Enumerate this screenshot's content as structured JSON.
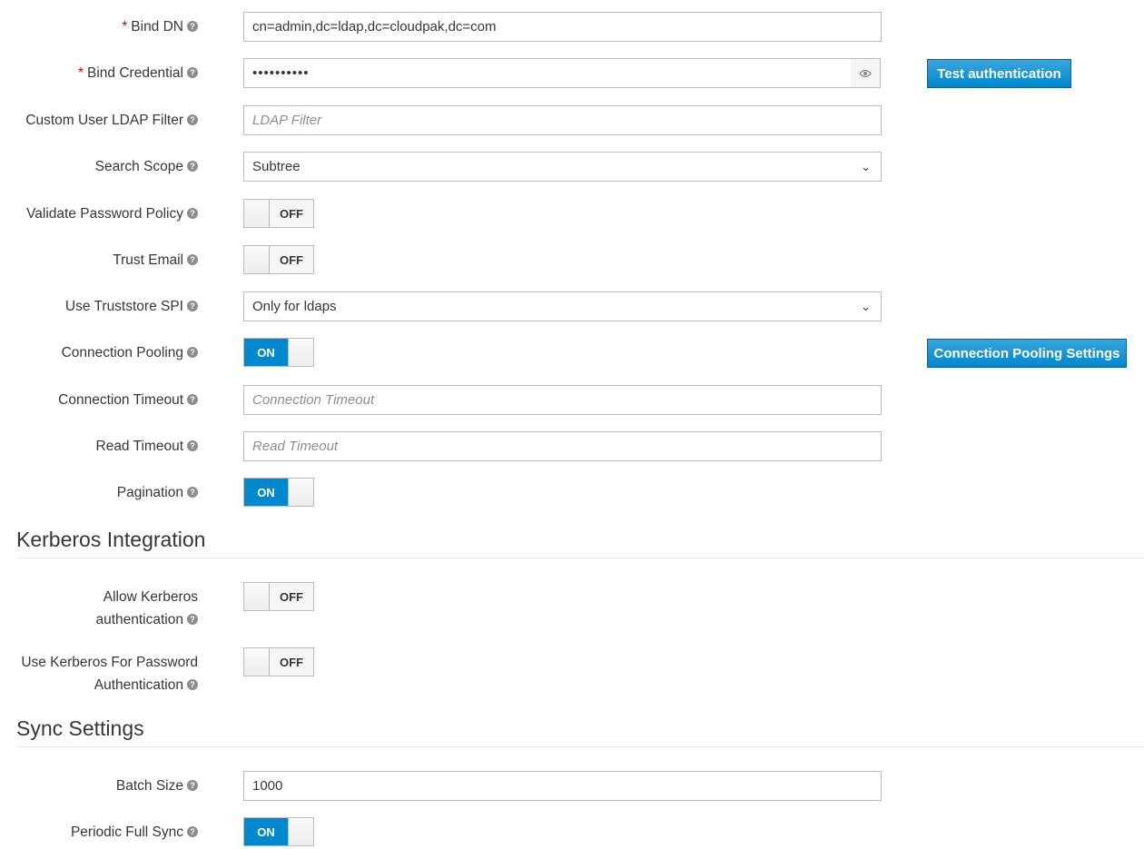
{
  "fields": {
    "bind_dn": {
      "label": "Bind DN",
      "value": "cn=admin,dc=ldap,dc=cloudpak,dc=com",
      "required": "*"
    },
    "bind_credential": {
      "label": "Bind Credential",
      "value": "••••••••••",
      "required": "*",
      "test_button": "Test authentication"
    },
    "custom_user_ldap_filter": {
      "label": "Custom User LDAP Filter",
      "placeholder": "LDAP Filter"
    },
    "search_scope": {
      "label": "Search Scope",
      "selected": "Subtree"
    },
    "validate_password_policy": {
      "label": "Validate Password Policy",
      "state": "OFF"
    },
    "trust_email": {
      "label": "Trust Email",
      "state": "OFF"
    },
    "use_truststore_spi": {
      "label": "Use Truststore SPI",
      "selected": "Only for ldaps"
    },
    "connection_pooling": {
      "label": "Connection Pooling",
      "state": "ON",
      "settings_button": "Connection Pooling Settings"
    },
    "connection_timeout": {
      "label": "Connection Timeout",
      "placeholder": "Connection Timeout"
    },
    "read_timeout": {
      "label": "Read Timeout",
      "placeholder": "Read Timeout"
    },
    "pagination": {
      "label": "Pagination",
      "state": "ON"
    }
  },
  "kerberos": {
    "title": "Kerberos Integration",
    "allow_kerberos": {
      "label_line1": "Allow Kerberos",
      "label_line2": "authentication",
      "state": "OFF"
    },
    "use_kerberos_password": {
      "label_line1": "Use Kerberos For Password",
      "label_line2": "Authentication",
      "state": "OFF"
    }
  },
  "sync": {
    "title": "Sync Settings",
    "batch_size": {
      "label": "Batch Size",
      "value": "1000"
    },
    "periodic_full_sync": {
      "label": "Periodic Full Sync",
      "state": "ON"
    }
  },
  "icons": {
    "help": "question-circle-icon",
    "eye": "eye-icon",
    "chevron": "chevron-down-icon"
  },
  "colors": {
    "primary": "#0088ce",
    "required": "#cc0000"
  }
}
